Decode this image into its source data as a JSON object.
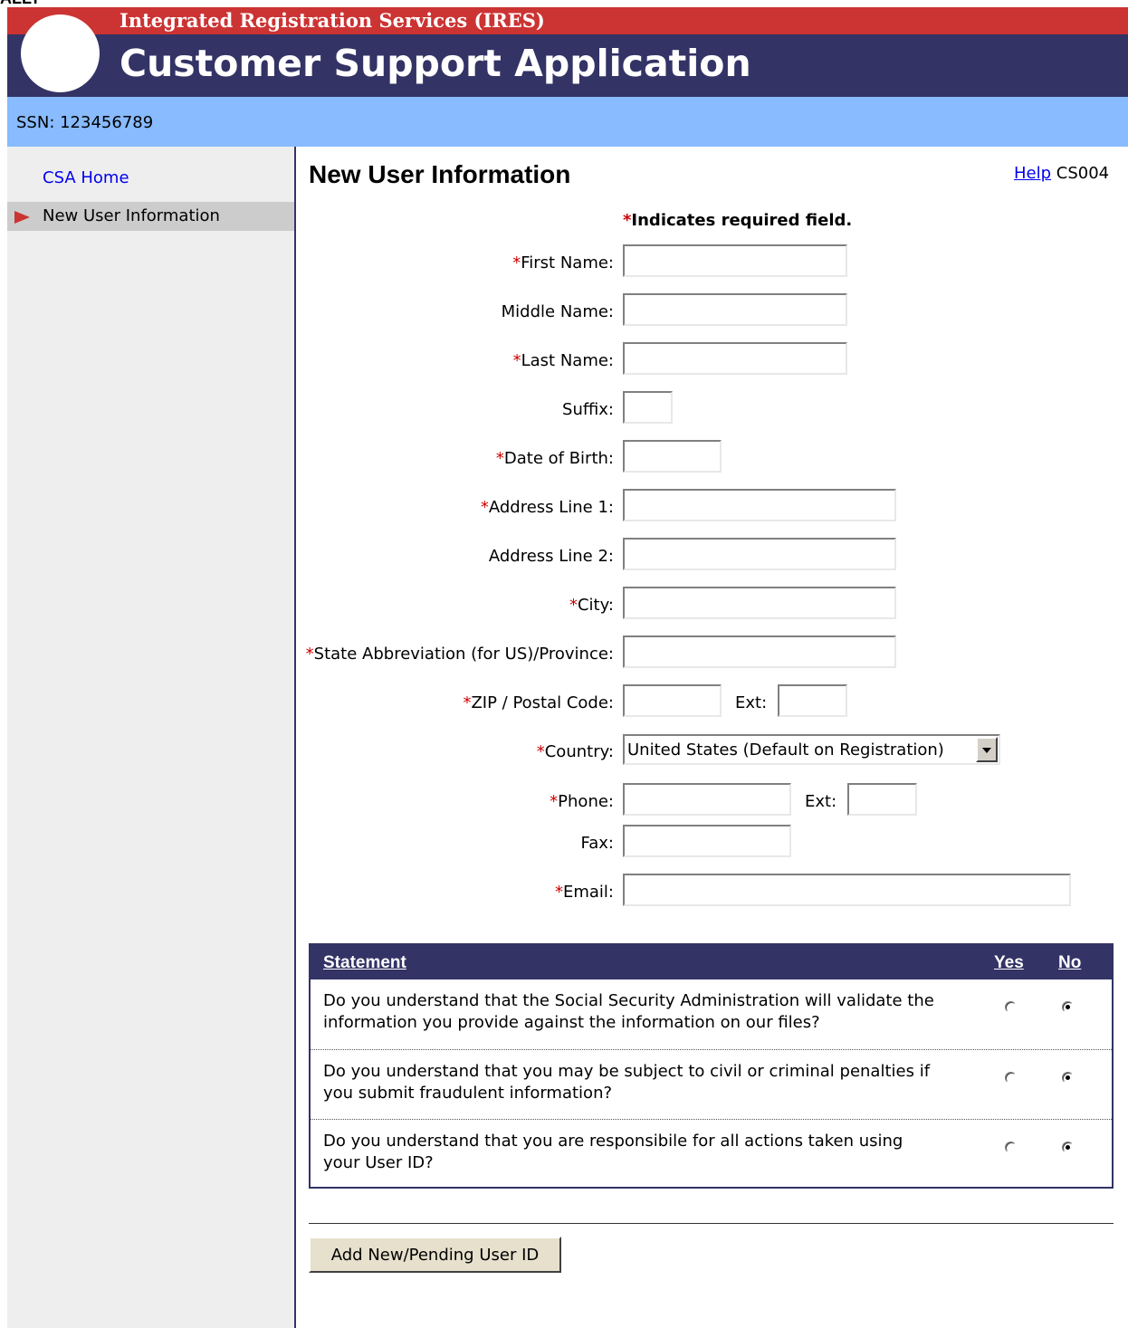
{
  "header": {
    "top_clip": "ALLT",
    "subtitle": "Integrated Registration Services (IRES)",
    "title": "Customer Support Application",
    "ssn": "SSN: 123456789",
    "colors": {
      "red": "#cc3333",
      "navy": "#333366",
      "light_blue": "#88bbff"
    }
  },
  "sidebar": {
    "home": "CSA Home",
    "active": "New User Information"
  },
  "main": {
    "page_title": "New User Information",
    "help": "Help",
    "page_code": "CS004",
    "req_star": "*",
    "req_note": "Indicates required field.",
    "fields": {
      "first_name": "First Name:",
      "middle_name": "Middle Name:",
      "last_name": "Last Name:",
      "suffix": "Suffix:",
      "dob": "Date of Birth:",
      "addr1": "Address Line 1:",
      "addr2": "Address Line 2:",
      "city": "City:",
      "state": "State Abbreviation (for US)/Province:",
      "zip": "ZIP / Postal Code:",
      "zip_ext": "Ext:",
      "country": "Country:",
      "country_value": "United States (Default on Registration)",
      "phone": "Phone:",
      "phone_ext": "Ext:",
      "fax": "Fax:",
      "email": "Email:"
    },
    "statements": {
      "col_statement": "Statement",
      "col_yes": "Yes",
      "col_no": "No",
      "rows": [
        {
          "text": "Do you understand that the Social Security Administration will validate the information you provide against the information on our files?",
          "selected": "No"
        },
        {
          "text": "Do you understand that you may be subject to civil or criminal penalties if you submit fraudulent information?",
          "selected": "No"
        },
        {
          "text": "Do you understand that you are responsibile for all actions taken using your User ID?",
          "selected": "No"
        }
      ]
    },
    "submit": "Add New/Pending User ID"
  }
}
